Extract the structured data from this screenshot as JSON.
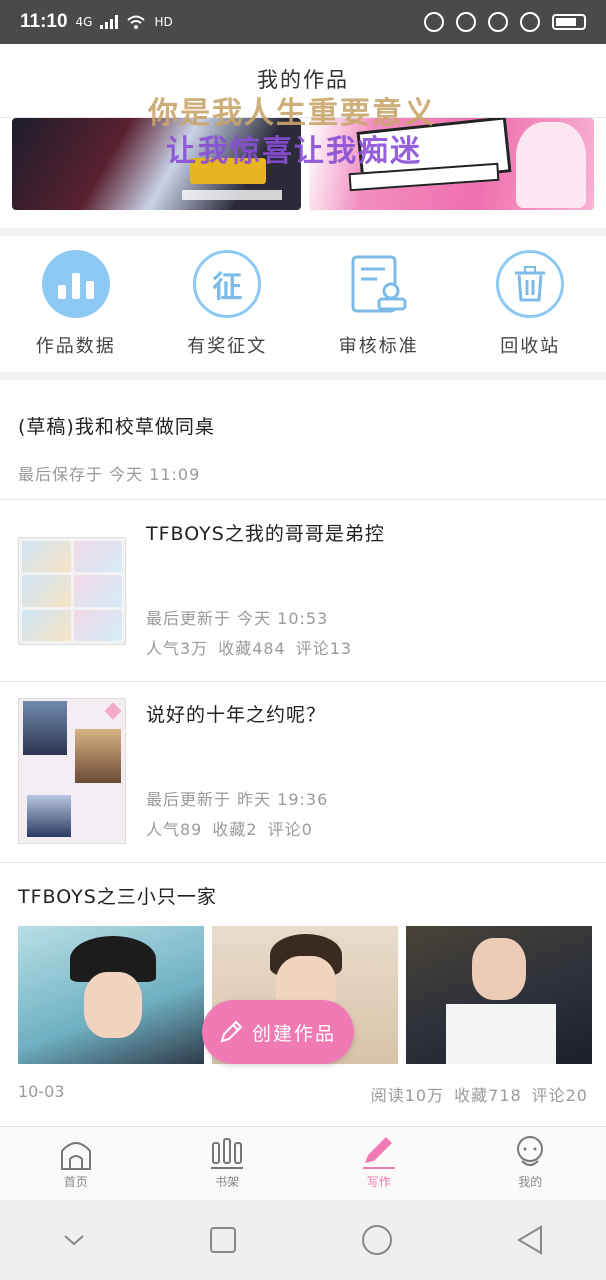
{
  "status_bar": {
    "time": "11:10",
    "network_label": "4G",
    "hd_label": "HD"
  },
  "header": {
    "title": "我的作品",
    "overlay_line1": "你是我人生重要意义",
    "overlay_line2": "让我惊喜让我痴迷"
  },
  "quick_actions": [
    {
      "label": "作品数据",
      "icon": "bar-chart-icon"
    },
    {
      "label": "有奖征文",
      "icon": "contest-icon",
      "glyph": "征"
    },
    {
      "label": "审核标准",
      "icon": "review-icon"
    },
    {
      "label": "回收站",
      "icon": "trash-icon"
    }
  ],
  "draft": {
    "title": "(草稿)我和校草做同桌",
    "saved": "最后保存于 今天 11:09"
  },
  "works": [
    {
      "title": "TFBOYS之我的哥哥是弟控",
      "updated": "最后更新于 今天 10:53",
      "popularity": "人气3万",
      "favorites": "收藏484",
      "comments": "评论13"
    },
    {
      "title": "说好的十年之约呢？",
      "updated": "最后更新于 昨天 19:36",
      "popularity": "人气89",
      "favorites": "收藏2",
      "comments": "评论0"
    }
  ],
  "feature": {
    "title": "TFBOYS之三小只一家",
    "date": "10-03",
    "reads": "阅读10万",
    "favorites": "收藏718",
    "comments": "评论20",
    "create_label": "创建作品"
  },
  "tabs": [
    {
      "label": "首页",
      "icon": "home-icon"
    },
    {
      "label": "书架",
      "icon": "bookshelf-icon"
    },
    {
      "label": "写作",
      "icon": "pencil-icon",
      "active": true
    },
    {
      "label": "我的",
      "icon": "profile-icon"
    }
  ],
  "colors": {
    "accent": "#f07ab3",
    "blue": "#8dc9f2",
    "muted": "#9a9a9a"
  }
}
